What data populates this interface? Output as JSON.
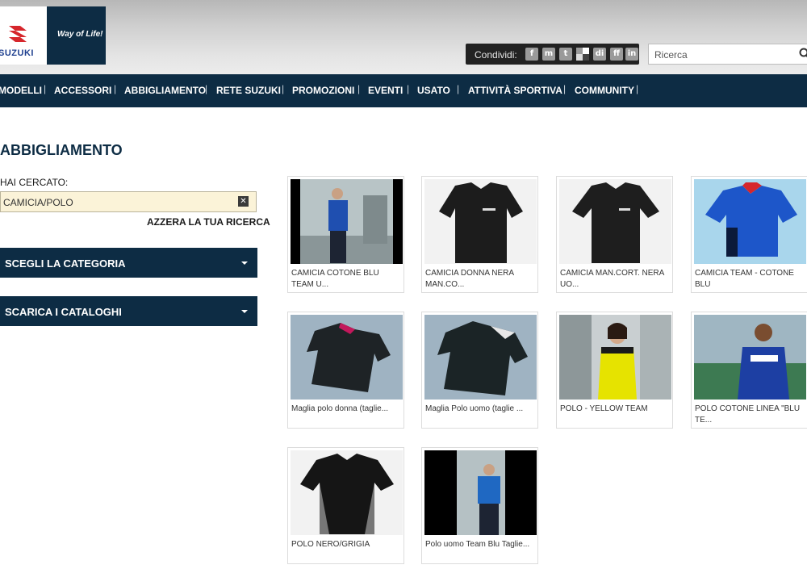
{
  "brand": {
    "logo_text": "SUZUKI",
    "slogan": "Way of Life!"
  },
  "share": {
    "label": "Condividi:",
    "icons": [
      "facebook-icon",
      "myspace-icon",
      "twitter-icon",
      "delicious-icon",
      "digg-icon",
      "friendfeed-icon",
      "linkedin-icon"
    ],
    "glyphs": [
      "f",
      "m",
      "t",
      "",
      "di",
      "ff",
      "in"
    ]
  },
  "search": {
    "placeholder": "Ricerca"
  },
  "nav": {
    "items": [
      "MODELLI",
      "ACCESSORI",
      "ABBIGLIAMENTO",
      "RETE SUZUKI",
      "PROMOZIONI",
      "EVENTI",
      "USATO",
      "ATTIVITÀ SPORTIVA",
      "COMMUNITY"
    ]
  },
  "page": {
    "title": "ABBIGLIAMENTO",
    "searched_label": "HAI CERCATO:",
    "searched_value": "CAMICIA/POLO",
    "reset_label": "AZZERA LA TUA RICERCA"
  },
  "sidebar": {
    "category_label": "SCEGLI LA CATEGORIA",
    "catalogs_label": "SCARICA I CATALOGHI"
  },
  "products": [
    {
      "caption": "CAMICIA COTONE BLU TEAM U..."
    },
    {
      "caption": "CAMICIA DONNA NERA MAN.CO..."
    },
    {
      "caption": "CAMICIA MAN.CORT. NERA UO..."
    },
    {
      "caption": "CAMICIA TEAM - COTONE BLU"
    },
    {
      "caption": "Maglia polo donna (taglie..."
    },
    {
      "caption": "Maglia Polo uomo (taglie ..."
    },
    {
      "caption": "POLO - YELLOW TEAM"
    },
    {
      "caption": "POLO COTONE LINEA \"BLU TE..."
    },
    {
      "caption": "POLO NERO/GRIGIA"
    },
    {
      "caption": "Polo uomo Team Blu Taglie..."
    }
  ],
  "colors": {
    "navy": "#0d2c44",
    "field": "#fbf3d8",
    "brand_red": "#d6262c",
    "brand_blue": "#1e3f8f"
  }
}
